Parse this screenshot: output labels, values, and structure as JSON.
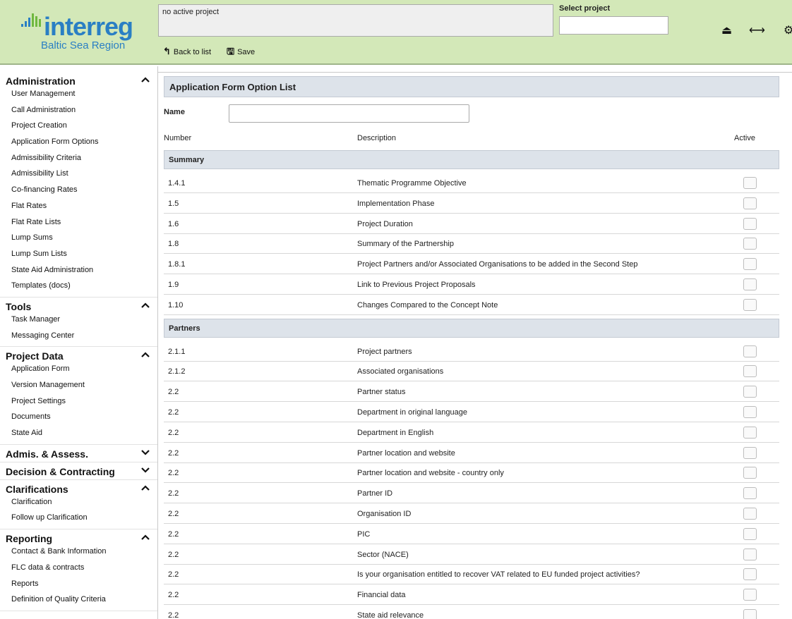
{
  "header": {
    "logo_text": "interreg",
    "logo_sub": "Baltic Sea Region",
    "active_project": "no active project",
    "select_label": "Select project",
    "select_value": "",
    "back_label": "Back to list",
    "save_label": "Save",
    "icons": [
      "eject-icon",
      "resize-horizontal-icon",
      "gear-icon"
    ]
  },
  "sidebar": {
    "sections": [
      {
        "title": "Administration",
        "expanded": true,
        "items": [
          "User Management",
          "Call Administration",
          "Project Creation",
          "Application Form Options",
          "Admissibility Criteria",
          "Admissibility List",
          "Co-financing Rates",
          "Flat Rates",
          "Flat Rate Lists",
          "Lump Sums",
          "Lump Sum Lists",
          "State Aid Administration",
          "Templates (docs)"
        ]
      },
      {
        "title": "Tools",
        "expanded": true,
        "items": [
          "Task Manager",
          "Messaging Center"
        ]
      },
      {
        "title": "Project Data",
        "expanded": true,
        "items": [
          "Application Form",
          "Version Management",
          "Project Settings",
          "Documents",
          "State Aid"
        ]
      },
      {
        "title": "Admis. & Assess.",
        "expanded": false,
        "items": []
      },
      {
        "title": "Decision & Contracting",
        "expanded": false,
        "items": []
      },
      {
        "title": "Clarifications",
        "expanded": true,
        "items": [
          "Clarification",
          "Follow up Clarification"
        ]
      },
      {
        "title": "Reporting",
        "expanded": true,
        "items": [
          "Contact & Bank Information",
          "FLC data & contracts",
          "Reports",
          "Definition of Quality Criteria"
        ]
      }
    ]
  },
  "main": {
    "title": "Application Form Option List",
    "name_label": "Name",
    "name_value": "",
    "columns": {
      "number": "Number",
      "description": "Description",
      "active": "Active"
    },
    "groups": [
      {
        "title": "Summary",
        "rows": [
          {
            "number": "1.4.1",
            "description": "Thematic Programme Objective",
            "active": false
          },
          {
            "number": "1.5",
            "description": "Implementation Phase",
            "active": false
          },
          {
            "number": "1.6",
            "description": "Project Duration",
            "active": false
          },
          {
            "number": "1.8",
            "description": "Summary of the Partnership",
            "active": false
          },
          {
            "number": "1.8.1",
            "description": "Project Partners and/or Associated Organisations to be added in the Second Step",
            "active": false
          },
          {
            "number": "1.9",
            "description": "Link to Previous Project Proposals",
            "active": false
          },
          {
            "number": "1.10",
            "description": "Changes Compared to the Concept Note",
            "active": false
          }
        ]
      },
      {
        "title": "Partners",
        "rows": [
          {
            "number": "2.1.1",
            "description": "Project partners",
            "active": false
          },
          {
            "number": "2.1.2",
            "description": "Associated organisations",
            "active": false
          },
          {
            "number": "2.2",
            "description": "Partner status",
            "active": false
          },
          {
            "number": "2.2",
            "description": "Department in original language",
            "active": false
          },
          {
            "number": "2.2",
            "description": "Department in English",
            "active": false
          },
          {
            "number": "2.2",
            "description": "Partner location and website",
            "active": false
          },
          {
            "number": "2.2",
            "description": "Partner location and website - country only",
            "active": false
          },
          {
            "number": "2.2",
            "description": "Partner ID",
            "active": false
          },
          {
            "number": "2.2",
            "description": "Organisation ID",
            "active": false
          },
          {
            "number": "2.2",
            "description": "PIC",
            "active": false
          },
          {
            "number": "2.2",
            "description": "Sector (NACE)",
            "active": false
          },
          {
            "number": "2.2",
            "description": "Is your organisation entitled to recover VAT related to EU funded project activities?",
            "active": false
          },
          {
            "number": "2.2",
            "description": "Financial data",
            "active": false
          },
          {
            "number": "2.2",
            "description": "State aid relevance",
            "active": false
          }
        ]
      }
    ]
  }
}
